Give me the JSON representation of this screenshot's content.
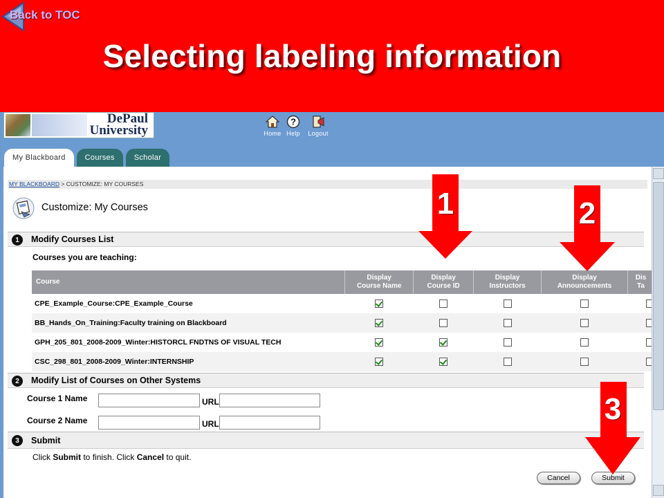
{
  "slide": {
    "back_link": "Back to TOC",
    "title": "Selecting labeling information"
  },
  "institution": {
    "logo_line1": "DePaul",
    "logo_line2": "University"
  },
  "top_nav": {
    "home": "Home",
    "help": "Help",
    "logout": "Logout"
  },
  "tabs": [
    {
      "label": "My Blackboard",
      "active": true
    },
    {
      "label": "Courses",
      "active": false
    },
    {
      "label": "Scholar",
      "active": false
    }
  ],
  "breadcrumb": {
    "root": "MY BLACKBOARD",
    "separator": " > ",
    "current": "CUSTOMIZE: MY COURSES"
  },
  "page_title": "Customize: My Courses",
  "section1": {
    "number": "1",
    "title": "Modify Courses List",
    "subtitle": "Courses you are teaching:",
    "columns": [
      "Course",
      "Display Course Name",
      "Display Course ID",
      "Display Instructors",
      "Display Announcements",
      "Dis Ta"
    ],
    "rows": [
      {
        "course": "CPE_Example_Course:CPE_Example_Course",
        "checks": [
          true,
          false,
          false,
          false,
          false
        ]
      },
      {
        "course": "BB_Hands_On_Training:Faculty training on Blackboard",
        "checks": [
          true,
          false,
          false,
          false,
          false
        ]
      },
      {
        "course": "GPH_205_801_2008-2009_Winter:HISTORCL FNDTNS OF VISUAL TECH",
        "checks": [
          true,
          true,
          false,
          false,
          false
        ]
      },
      {
        "course": "CSC_298_801_2008-2009_Winter:INTERNSHIP",
        "checks": [
          true,
          true,
          false,
          false,
          false
        ]
      }
    ]
  },
  "section2": {
    "number": "2",
    "title": "Modify List of Courses on Other Systems",
    "course1_label": "Course 1 Name",
    "course2_label": "Course 2 Name",
    "url_label": "URL",
    "course1_value": "",
    "course1_url": "",
    "course2_value": "",
    "course2_url": ""
  },
  "section3": {
    "number": "3",
    "title": "Submit",
    "instruction_pre": "Click ",
    "instruction_submit": "Submit",
    "instruction_mid": " to finish. Click ",
    "instruction_cancel": "Cancel",
    "instruction_post": " to quit.",
    "cancel_label": "Cancel",
    "submit_label": "Submit"
  },
  "annotations": {
    "arrow1": "1",
    "arrow2": "2",
    "arrow3": "3"
  },
  "colors": {
    "slide_red": "#ff0000",
    "bb_blue": "#6b9bd1",
    "tab_teal": "#2e6f6f",
    "header_gray": "#999aa0"
  }
}
